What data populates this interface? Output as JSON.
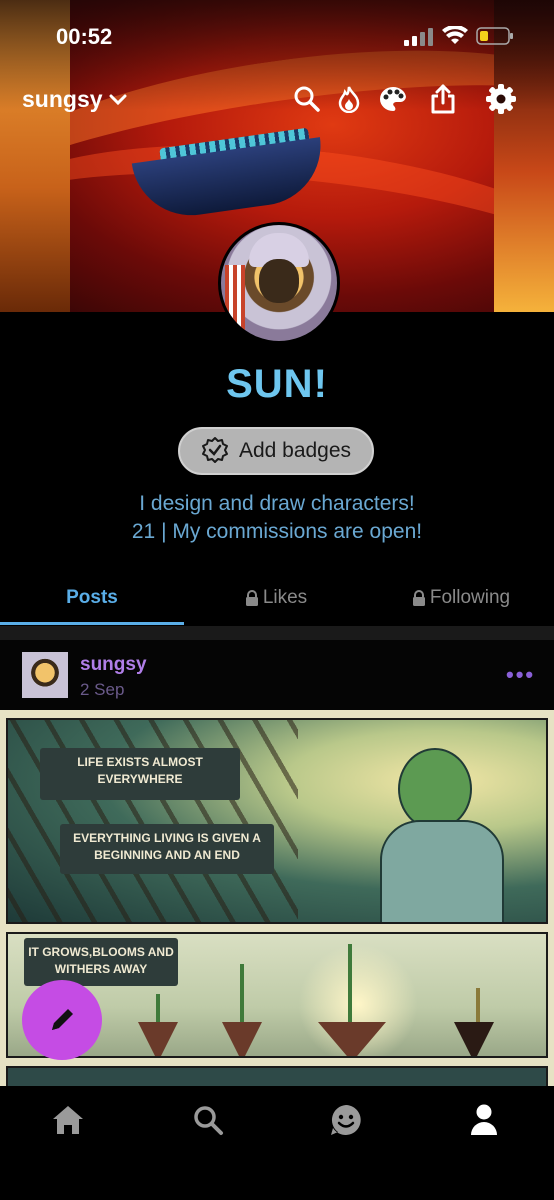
{
  "status_bar": {
    "time": "00:52"
  },
  "header": {
    "blog_name": "sungsy"
  },
  "profile": {
    "title": "SUN!",
    "add_badges_label": "Add badges",
    "description_line1": "I design and draw characters!",
    "description_line2": "21 | My commissions are open!"
  },
  "tabs": [
    {
      "label": "Posts",
      "active": true,
      "locked": false
    },
    {
      "label": "Likes",
      "active": false,
      "locked": true
    },
    {
      "label": "Following",
      "active": false,
      "locked": true
    }
  ],
  "post": {
    "username": "sungsy",
    "date": "2 Sep",
    "captions": [
      "LIFE EXISTS ALMOST EVERYWHERE",
      "EVERYTHING LIVING IS GIVEN A BEGINNING AND AN END",
      "IT GROWS,BLOOMS AND WITHERS AWAY"
    ]
  },
  "colors": {
    "accent_blue": "#6ec6ef",
    "tab_active": "#5aaee8",
    "username_purple": "#b07ee8",
    "fab_purple": "#c54ce4"
  },
  "icons": {
    "header": [
      "search-icon",
      "flame-icon",
      "palette-icon",
      "share-icon",
      "gear-icon"
    ],
    "bottom_nav": [
      "home-icon",
      "search-icon",
      "smiley-icon",
      "profile-icon"
    ]
  }
}
